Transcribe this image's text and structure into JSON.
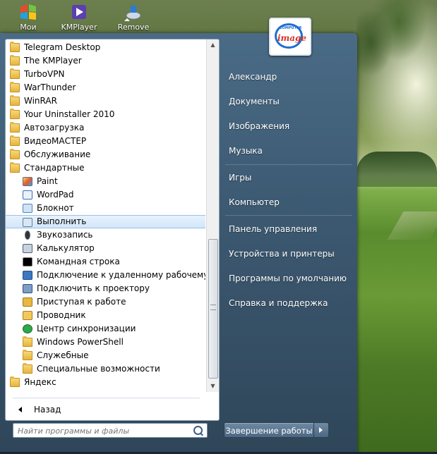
{
  "desktop": {
    "icons": [
      {
        "label": "Мои",
        "icon": "computer-icon"
      },
      {
        "label": "KMPlayer",
        "icon": "kmplayer-icon"
      },
      {
        "label": "Remove",
        "icon": "uninstaller-icon"
      }
    ]
  },
  "start_menu": {
    "programs": [
      {
        "label": "Telegram Desktop",
        "icon": "folder-icon",
        "type": "folder"
      },
      {
        "label": "The KMPlayer",
        "icon": "folder-icon",
        "type": "folder"
      },
      {
        "label": "TurboVPN",
        "icon": "folder-icon",
        "type": "folder"
      },
      {
        "label": "WarThunder",
        "icon": "folder-icon",
        "type": "folder"
      },
      {
        "label": "WinRAR",
        "icon": "folder-icon",
        "type": "folder"
      },
      {
        "label": "Your Uninstaller 2010",
        "icon": "folder-icon",
        "type": "folder"
      },
      {
        "label": "Автозагрузка",
        "icon": "folder-icon",
        "type": "folder"
      },
      {
        "label": "ВидеоМАСТЕР",
        "icon": "folder-icon",
        "type": "folder"
      },
      {
        "label": "Обслуживание",
        "icon": "folder-icon",
        "type": "folder"
      },
      {
        "label": "Стандартные",
        "icon": "folder-icon",
        "type": "folder"
      },
      {
        "label": "Paint",
        "icon": "paint-icon",
        "type": "app"
      },
      {
        "label": "WordPad",
        "icon": "wordpad-icon",
        "type": "app"
      },
      {
        "label": "Блокнот",
        "icon": "notepad-icon",
        "type": "app"
      },
      {
        "label": "Выполнить",
        "icon": "run-icon",
        "type": "app",
        "selected": true
      },
      {
        "label": "Звукозапись",
        "icon": "microphone-icon",
        "type": "app"
      },
      {
        "label": "Калькулятор",
        "icon": "calculator-icon",
        "type": "app"
      },
      {
        "label": "Командная строка",
        "icon": "command-prompt-icon",
        "type": "app"
      },
      {
        "label": "Подключение к удаленному рабочему столу",
        "icon": "remote-desktop-icon",
        "type": "app"
      },
      {
        "label": "Подключить к проектору",
        "icon": "projector-icon",
        "type": "app"
      },
      {
        "label": "Приступая к работе",
        "icon": "getting-started-icon",
        "type": "app"
      },
      {
        "label": "Проводник",
        "icon": "explorer-icon",
        "type": "app"
      },
      {
        "label": "Центр синхронизации",
        "icon": "sync-center-icon",
        "type": "app"
      },
      {
        "label": "Windows PowerShell",
        "icon": "folder-icon",
        "type": "subfolder"
      },
      {
        "label": "Служебные",
        "icon": "folder-icon",
        "type": "subfolder"
      },
      {
        "label": "Специальные возможности",
        "icon": "folder-icon",
        "type": "subfolder"
      },
      {
        "label": "Яндекс",
        "icon": "folder-icon",
        "type": "folder"
      }
    ],
    "back_label": "Назад",
    "search_placeholder": "Найти программы и файлы",
    "right_items": [
      {
        "label": "Александр"
      },
      {
        "label": "Документы"
      },
      {
        "label": "Изображения"
      },
      {
        "label": "Музыка"
      },
      {
        "label": "Игры"
      },
      {
        "label": "Компьютер"
      },
      {
        "label": "Панель управления"
      },
      {
        "label": "Устройства и принтеры"
      },
      {
        "label": "Программы по умолчанию"
      },
      {
        "label": "Справка и поддержка"
      }
    ],
    "shutdown_label": "Завершение работы",
    "user_picture_text": "image",
    "user_picture_small_text": "COMPUTER"
  },
  "colors": {
    "menu_bg": "#3d5a73",
    "selected_bg": "#d2e6fa",
    "folder": "#e7b43b"
  }
}
